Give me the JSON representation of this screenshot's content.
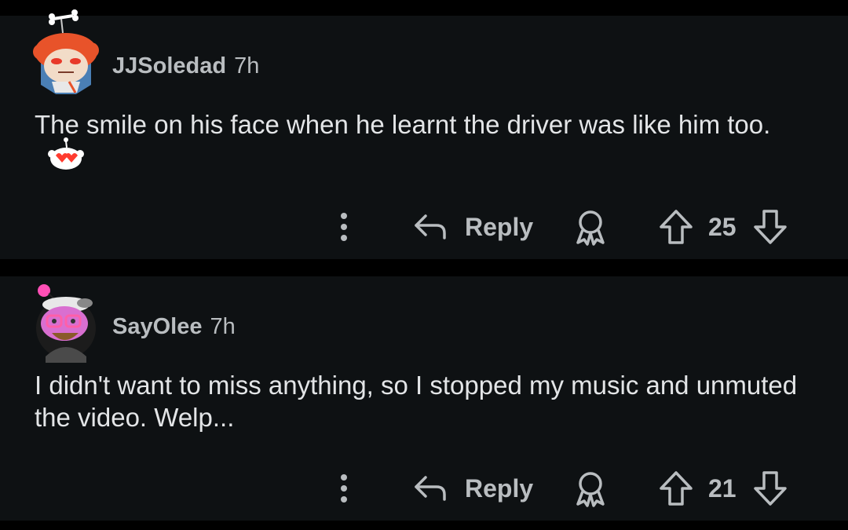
{
  "comments": [
    {
      "username": "JJSoledad",
      "time": "7h",
      "body": "The smile on his face when he learnt the driver was like him too.",
      "reply_label": "Reply",
      "votes": "25",
      "icons": {
        "avatar": "avatar-orange-hair-icon",
        "emoji": "snoo-heart-eyes-icon",
        "more": "vertical-ellipsis-icon",
        "reply": "reply-arrow-icon",
        "award": "award-icon",
        "upvote": "upvote-arrow-icon",
        "downvote": "downvote-arrow-icon"
      }
    },
    {
      "username": "SayOlee",
      "time": "7h",
      "body": "I didn't want to miss anything, so I stopped my music and unmuted the video. Welp...",
      "reply_label": "Reply",
      "votes": "21",
      "icons": {
        "avatar": "avatar-pink-glasses-icon",
        "more": "vertical-ellipsis-icon",
        "reply": "reply-arrow-icon",
        "award": "award-icon",
        "upvote": "upvote-arrow-icon",
        "downvote": "downvote-arrow-icon"
      }
    }
  ],
  "colors": {
    "background": "#000000",
    "card": "#0e1113",
    "text": "#e3e5e7",
    "meta": "#b9bdc0"
  }
}
